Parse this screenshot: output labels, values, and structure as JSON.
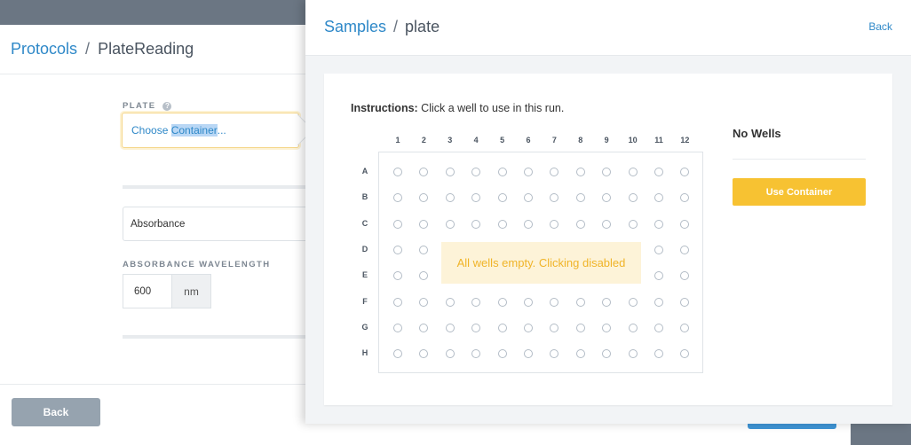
{
  "background": {
    "breadcrumb": {
      "parent": "Protocols",
      "separator": "/",
      "current": "PlateReading"
    },
    "plate_label": "PLATE",
    "help_glyph": "?",
    "plate_input": {
      "prefix": "Choose ",
      "highlight": "Container",
      "suffix": "..."
    },
    "absorbance_select": "Absorbance",
    "wavelength_label": "ABSORBANCE WAVELENGTH",
    "wavelength_value": "600",
    "wavelength_unit": "nm",
    "back_button": "Back"
  },
  "overlay": {
    "breadcrumb": {
      "parent": "Samples",
      "separator": "/",
      "current": "plate"
    },
    "back_link": "Back",
    "instructions": {
      "bold": "Instructions:",
      "text": " Click a well to use in this run."
    },
    "columns": [
      "1",
      "2",
      "3",
      "4",
      "5",
      "6",
      "7",
      "8",
      "9",
      "10",
      "11",
      "12"
    ],
    "rows": [
      "A",
      "B",
      "C",
      "D",
      "E",
      "F",
      "G",
      "H"
    ],
    "empty_message": "All wells empty. Clicking disabled",
    "selection_title": "No Wells",
    "use_button": "Use Container"
  },
  "colors": {
    "accent_blue": "#2e88c8",
    "warning_yellow": "#f7c232",
    "warning_bg": "#fdf3d8"
  }
}
